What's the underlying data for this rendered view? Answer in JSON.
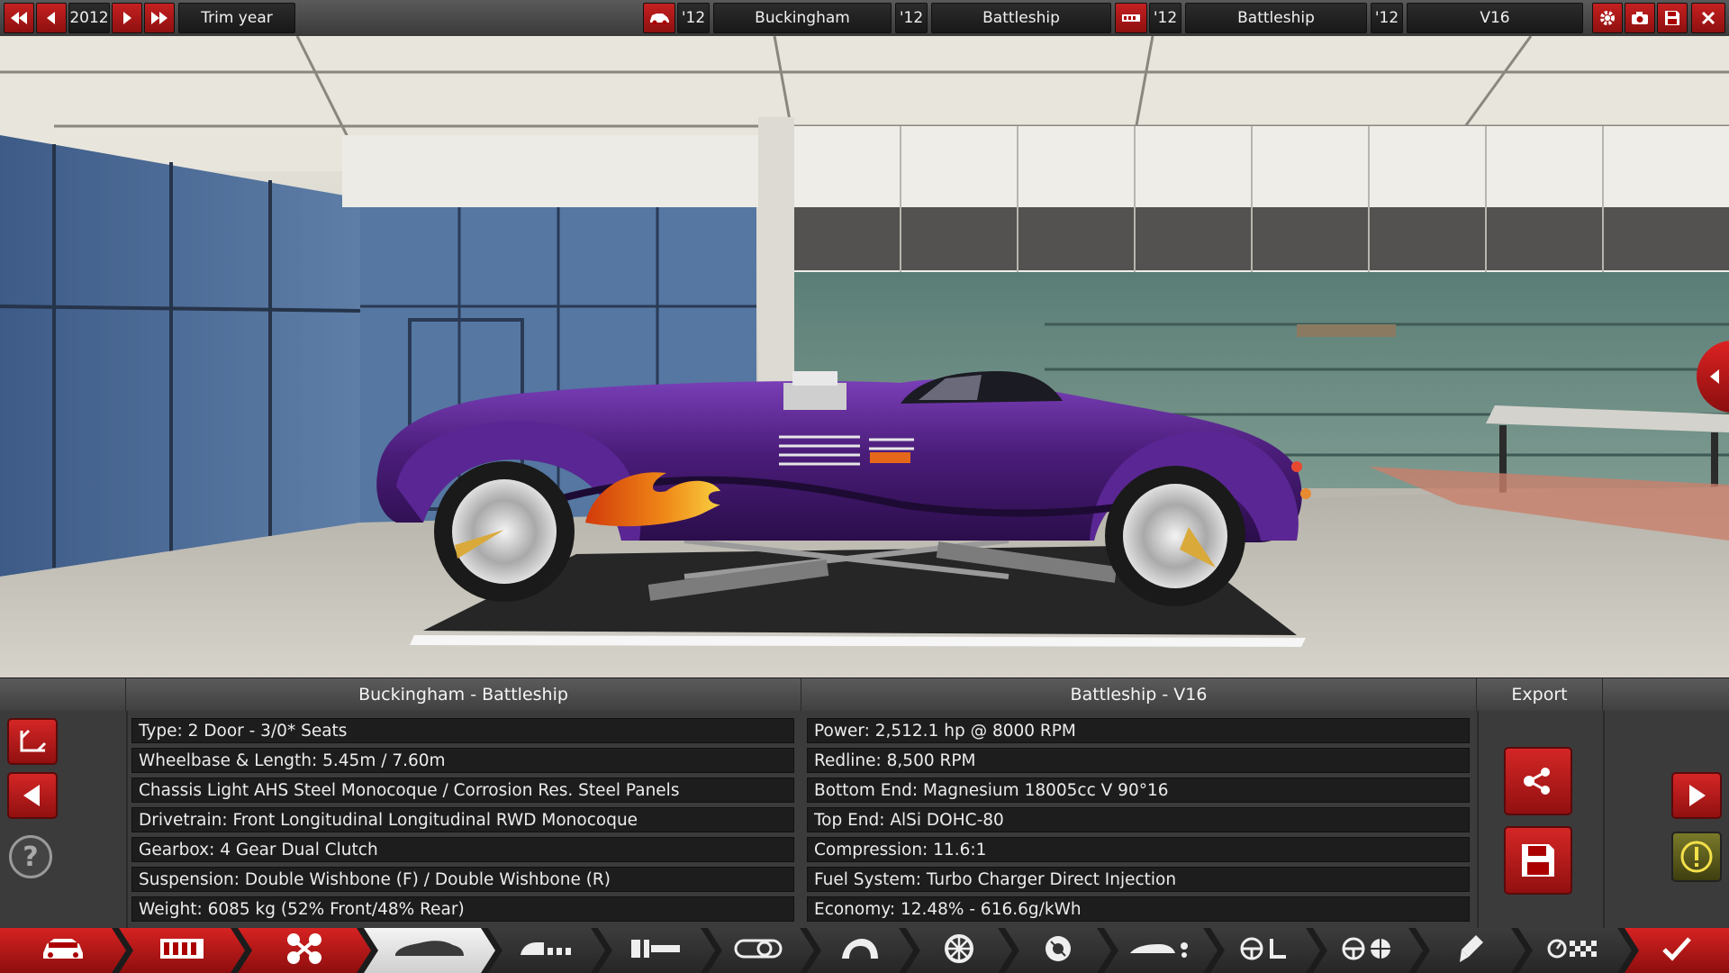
{
  "topbar": {
    "year": "2012",
    "trim_label": "Trim year",
    "model_year": "'12",
    "model_name": "Buckingham",
    "trim_year": "'12",
    "trim_name": "Battleship",
    "engine_family_year": "'12",
    "engine_family_name": "Battleship",
    "engine_variant_year": "'12",
    "engine_variant_name": "V16",
    "icons": [
      "rewind-icon",
      "step-back-icon",
      "play-icon",
      "fast-forward-icon",
      "car-body-icon",
      "engine-block-icon",
      "gear-icon",
      "camera-icon",
      "save-icon",
      "close-icon"
    ]
  },
  "panel": {
    "car_header": "Buckingham - Battleship",
    "engine_header": "Battleship - V16",
    "export_header": "Export",
    "car_specs": [
      "Type: 2 Door - 3/0* Seats",
      "Wheelbase & Length: 5.45m / 7.60m",
      "Chassis Light AHS Steel Monocoque / Corrosion Res. Steel Panels",
      "Drivetrain: Front Longitudinal Longitudinal RWD Monocoque",
      "Gearbox: 4 Gear Dual Clutch",
      "Suspension: Double Wishbone (F) / Double Wishbone (R)",
      "Weight: 6085 kg (52% Front/48% Rear)"
    ],
    "engine_specs": [
      "Power: 2,512.1 hp @ 8000 RPM",
      "Redline:  8,500 RPM",
      "Bottom End: Magnesium 18005cc V 90°16",
      "Top End: AlSi DOHC-80",
      "Compression: 11.6:1",
      "Fuel System: Turbo Charger Direct Injection",
      "Economy: 12.48% - 616.6g/kWh"
    ],
    "help_glyph": "?",
    "icons": [
      "camera-angle-icon",
      "back-arrow-icon",
      "help-icon",
      "share-icon",
      "save-icon",
      "next-arrow-icon",
      "warning-icon"
    ]
  },
  "tabs": [
    {
      "id": "model",
      "icon": "car-front-icon",
      "state": "done"
    },
    {
      "id": "chassis",
      "icon": "chassis-frame-icon",
      "state": "done"
    },
    {
      "id": "suspension",
      "icon": "suspension-icon",
      "state": "done"
    },
    {
      "id": "body",
      "icon": "car-body-icon",
      "state": "current"
    },
    {
      "id": "engine",
      "icon": "engine-bay-icon",
      "state": "todo"
    },
    {
      "id": "gearbox",
      "icon": "gearbox-icon",
      "state": "todo"
    },
    {
      "id": "exhaust",
      "icon": "exhaust-icon",
      "state": "todo"
    },
    {
      "id": "aero",
      "icon": "fender-icon",
      "state": "todo"
    },
    {
      "id": "wheels",
      "icon": "wheel-icon",
      "state": "todo"
    },
    {
      "id": "brakes",
      "icon": "brake-disc-icon",
      "state": "todo"
    },
    {
      "id": "tuning",
      "icon": "aero-tuning-icon",
      "state": "todo"
    },
    {
      "id": "interior",
      "icon": "steering-seat-icon",
      "state": "todo"
    },
    {
      "id": "safety",
      "icon": "steering-wheel-icon",
      "state": "todo"
    },
    {
      "id": "paint",
      "icon": "paint-brush-icon",
      "state": "todo"
    },
    {
      "id": "testing",
      "icon": "test-track-icon",
      "state": "todo"
    },
    {
      "id": "finish",
      "icon": "checkmark-icon",
      "state": "done"
    }
  ],
  "colors": {
    "accent_red": "#c81c1c",
    "car_purple": "#4b1d7a",
    "panel_bg": "#3b3b3b",
    "spec_bg": "#1d1d1d"
  }
}
